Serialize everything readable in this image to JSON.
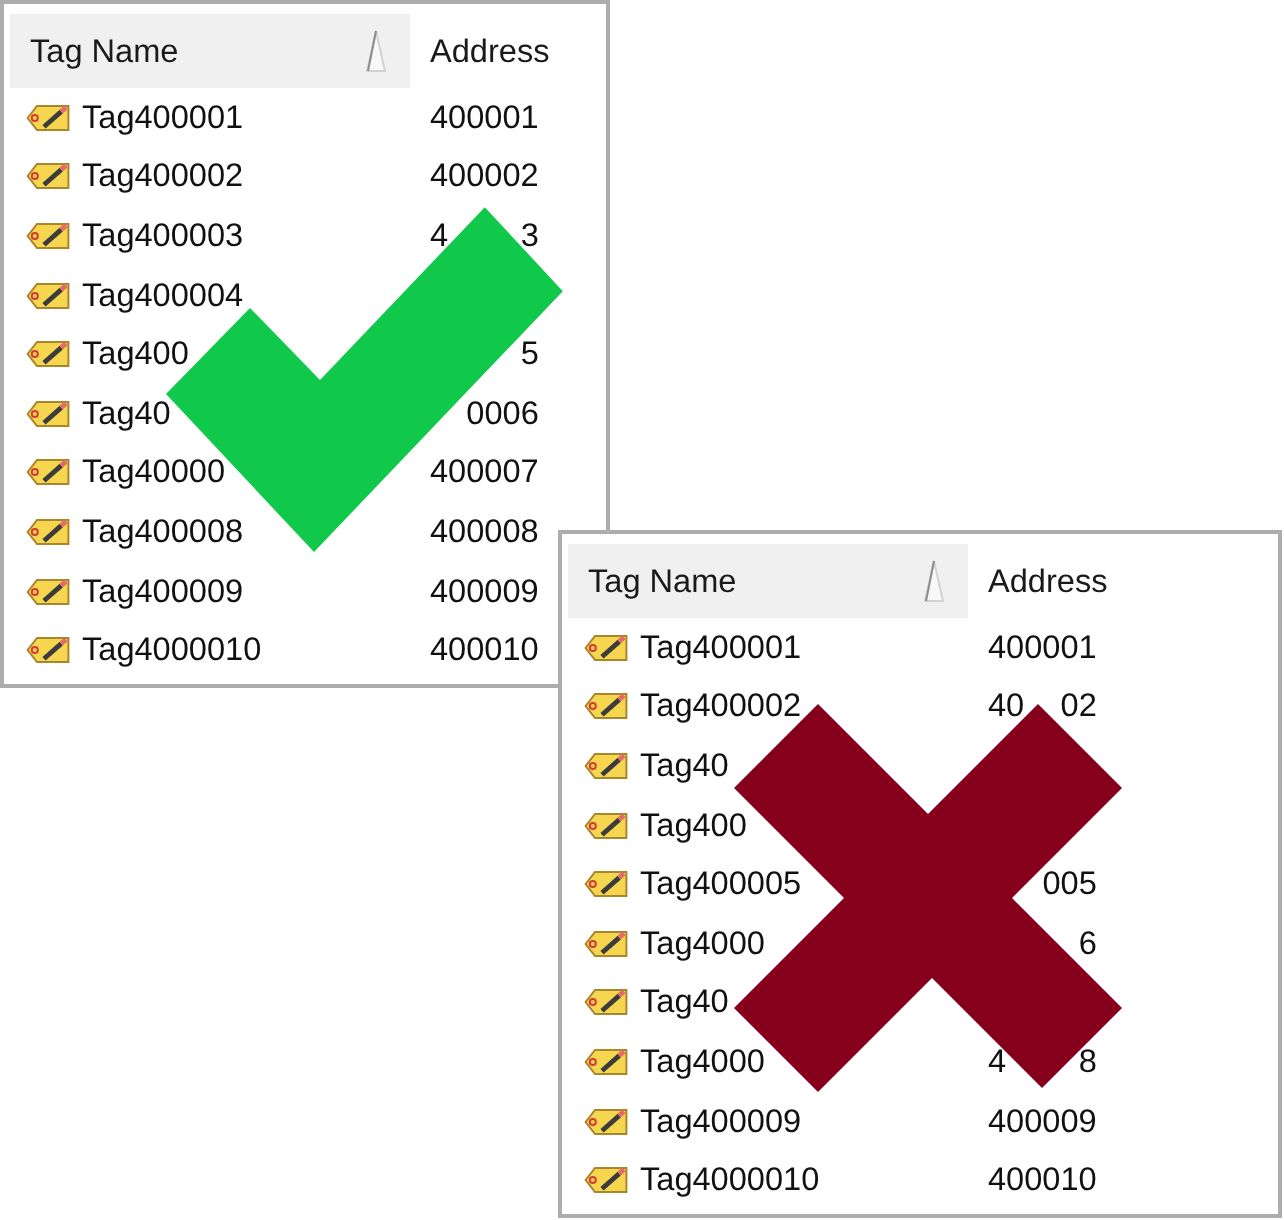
{
  "panels": [
    {
      "mark": {
        "kind": "check"
      },
      "columns": [
        {
          "label": "Tag Name",
          "sorted": true
        },
        {
          "label": "Address",
          "sorted": false
        }
      ],
      "rows": [
        {
          "tag_name": "Tag400001",
          "address": "400001"
        },
        {
          "tag_name": "Tag400002",
          "address": "400002"
        },
        {
          "tag_name": "Tag400003",
          "address": {
            "start": "4",
            "end": "3"
          }
        },
        {
          "tag_name": "Tag400004"
        },
        {
          "tag_name": "Tag400",
          "address": {
            "end": "5"
          }
        },
        {
          "tag_name": "Tag40",
          "address": {
            "end": "0006"
          }
        },
        {
          "tag_name": "Tag40000",
          "address": "400007"
        },
        {
          "tag_name": "Tag400008",
          "address": "400008"
        },
        {
          "tag_name": "Tag400009",
          "address": "400009"
        },
        {
          "tag_name": "Tag4000010",
          "address": "400010"
        }
      ]
    },
    {
      "mark": {
        "kind": "cross"
      },
      "columns": [
        {
          "label": "Tag Name",
          "sorted": true
        },
        {
          "label": "Address",
          "sorted": false
        }
      ],
      "rows": [
        {
          "tag_name": "Tag400001",
          "address": "400001"
        },
        {
          "tag_name": "Tag400002",
          "address": {
            "start": "40",
            "end": "02"
          }
        },
        {
          "tag_name": "Tag40"
        },
        {
          "tag_name": "Tag400"
        },
        {
          "tag_name": "Tag400005",
          "address": {
            "end": "005"
          }
        },
        {
          "tag_name": "Tag4000",
          "address": {
            "end": "6"
          }
        },
        {
          "tag_name": "Tag40"
        },
        {
          "tag_name": "Tag4000",
          "address": {
            "start": "4",
            "end": "8"
          }
        },
        {
          "tag_name": "Tag400009",
          "address": "400009"
        },
        {
          "tag_name": "Tag4000010",
          "address": "400010"
        }
      ]
    }
  ]
}
